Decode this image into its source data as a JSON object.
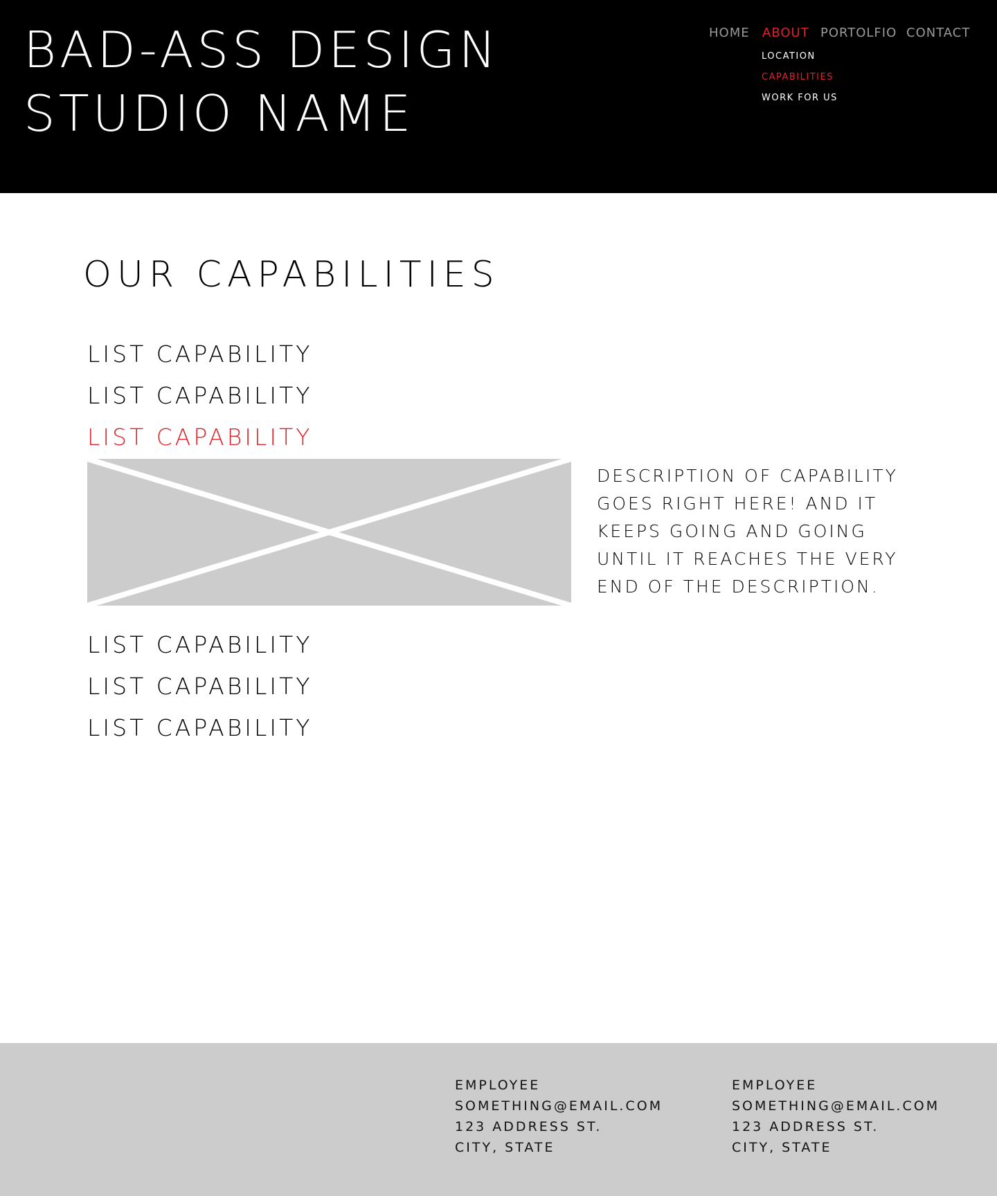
{
  "header": {
    "brand_line1": "BAD-ASS DESIGN",
    "brand_line2": "STUDIO NAME"
  },
  "nav": {
    "items": [
      {
        "label": "HOME",
        "active": false
      },
      {
        "label": "ABOUT",
        "active": true
      },
      {
        "label": "PORTOLFIO",
        "active": false
      },
      {
        "label": "CONTACT",
        "active": false
      }
    ],
    "subitems": [
      {
        "label": "LOCATION",
        "active": false
      },
      {
        "label": "CAPABILITIES",
        "active": true
      },
      {
        "label": "WORK FOR US",
        "active": false
      }
    ]
  },
  "main": {
    "title": "OUR CAPABILITIES",
    "capabilities": [
      {
        "label": "LIST CAPABILITY",
        "active": false
      },
      {
        "label": "LIST CAPABILITY",
        "active": false
      },
      {
        "label": "LIST CAPABILITY",
        "active": true
      },
      {
        "label": "LIST CAPABILITY",
        "active": false
      },
      {
        "label": "LIST CAPABILITY",
        "active": false
      },
      {
        "label": "LIST CAPABILITY",
        "active": false
      }
    ],
    "image_icon": "image-placeholder-icon",
    "description": "DESCRIPTION OF CAPABILITY\nGOES RIGHT HERE! AND IT\nKEEPS GOING AND GOING\nUNTIL IT REACHES THE VERY\nEND OF THE DESCRIPTION."
  },
  "footer": {
    "contacts": [
      {
        "name": "EMPLOYEE",
        "email": "SOMETHING@EMAIL.COM",
        "address": "123 ADDRESS ST.",
        "city": "CITY, STATE"
      },
      {
        "name": "EMPLOYEE",
        "email": "SOMETHING@EMAIL.COM",
        "address": "123 ADDRESS ST.",
        "city": "CITY, STATE"
      }
    ]
  },
  "colors": {
    "header_bg": "#000000",
    "accent": "#e0222a",
    "nav_inactive": "#9a9a9a",
    "placeholder_bg": "#cccccc",
    "footer_bg": "#cccccc"
  }
}
